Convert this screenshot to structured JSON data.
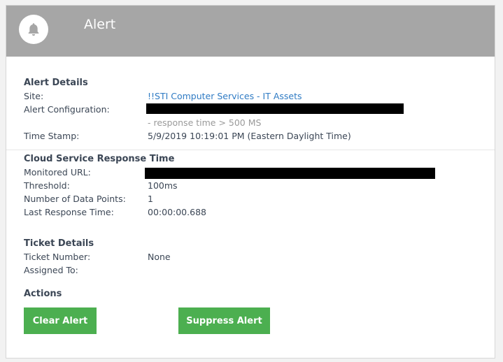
{
  "header": {
    "title": "Alert",
    "icon": "bell-icon"
  },
  "alert_details": {
    "title": "Alert Details",
    "site_label": "Site:",
    "site_value": "!!STI Computer Services - IT Assets",
    "config_label": "Alert Configuration:",
    "config_condition": "- response time > 500 MS",
    "timestamp_label": "Time Stamp:",
    "timestamp_value": "5/9/2019 10:19:01 PM (Eastern Daylight Time)"
  },
  "cloud_service": {
    "title": "Cloud Service Response Time",
    "url_label": "Monitored URL:",
    "threshold_label": "Threshold:",
    "threshold_value": "100ms",
    "datapoints_label": "Number of Data Points:",
    "datapoints_value": "1",
    "last_response_label": "Last Response Time:",
    "last_response_value": "00:00:00.688"
  },
  "ticket_details": {
    "title": "Ticket Details",
    "ticket_label": "Ticket Number:",
    "ticket_value": "None",
    "assigned_label": "Assigned To:"
  },
  "actions": {
    "title": "Actions",
    "clear_label": "Clear Alert",
    "suppress_label": "Suppress Alert"
  },
  "colors": {
    "header_bg": "#a6a6a6",
    "button_green": "#4caf50",
    "link_blue": "#2f7bc4",
    "redaction": "#000000"
  }
}
